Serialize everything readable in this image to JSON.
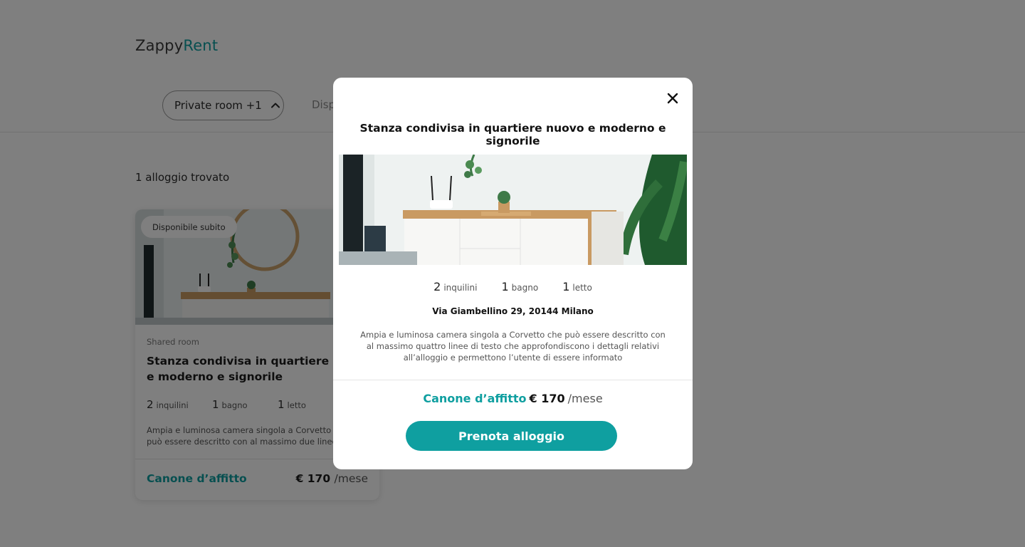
{
  "brand": {
    "name_part1": "Zappy",
    "name_part2": "Rent"
  },
  "filters": {
    "room_type_label": "Private room +1",
    "second_filter_partial": "Disp"
  },
  "results": {
    "count_label": "1 alloggio trovato"
  },
  "listing_card": {
    "badge": "Disponibile subito",
    "type": "Shared room",
    "title": "Stanza condivisa in quartiere nuovo e moderno e signorile",
    "specs": [
      {
        "value": "2",
        "unit": "inquilini"
      },
      {
        "value": "1",
        "unit": "bagno"
      },
      {
        "value": "1",
        "unit": "letto"
      }
    ],
    "description": "Ampia e luminosa camera singola a Corvetto che può essere descritto con al massimo due linee...",
    "rent_label": "Canone d’affitto",
    "rent_value": "€ 170",
    "rent_period": "/mese"
  },
  "modal": {
    "title": "Stanza condivisa in quartiere nuovo e moderno e signorile",
    "specs": [
      {
        "value": "2",
        "unit": "inquilini"
      },
      {
        "value": "1",
        "unit": "bagno"
      },
      {
        "value": "1",
        "unit": "letto"
      }
    ],
    "address": "Via Giambellino 29, 20144 Milano",
    "description": "Ampia e luminosa camera singola a Corvetto che può essere descritto con al massimo quattro linee di testo che approfondiscono i dettagli relativi all’alloggio e permettono l’utente di essere informato",
    "rent_label": "Canone d’affitto",
    "rent_value": "€ 170",
    "rent_period": "/mese",
    "cta_label": "Prenota alloggio"
  },
  "colors": {
    "accent": "#0f9fa0",
    "overlay": "rgba(0,0,0,0.5)"
  },
  "icons": {
    "close": "close-icon",
    "filter_toggle": "chevron-up-icon"
  }
}
